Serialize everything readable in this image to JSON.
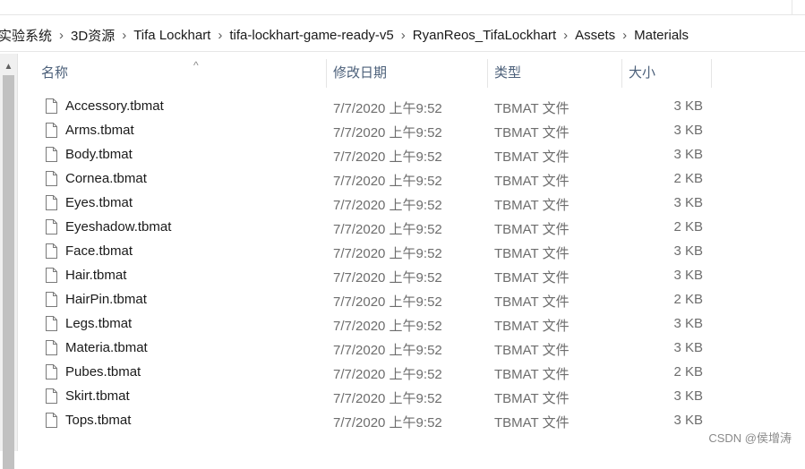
{
  "breadcrumbs": [
    "实验系统",
    "3D资源",
    "Tifa Lockhart",
    "tifa-lockhart-game-ready-v5",
    "RyanReos_TifaLockhart",
    "Assets",
    "Materials"
  ],
  "breadcrumb_separator": "›",
  "columns": {
    "name": "名称",
    "date": "修改日期",
    "type": "类型",
    "size": "大小"
  },
  "sort_indicator": "^",
  "scroll_up_arrow": "▲",
  "files": [
    {
      "name": "Accessory.tbmat",
      "date": "7/7/2020 上午9:52",
      "type": "TBMAT 文件",
      "size": "3 KB"
    },
    {
      "name": "Arms.tbmat",
      "date": "7/7/2020 上午9:52",
      "type": "TBMAT 文件",
      "size": "3 KB"
    },
    {
      "name": "Body.tbmat",
      "date": "7/7/2020 上午9:52",
      "type": "TBMAT 文件",
      "size": "3 KB"
    },
    {
      "name": "Cornea.tbmat",
      "date": "7/7/2020 上午9:52",
      "type": "TBMAT 文件",
      "size": "2 KB"
    },
    {
      "name": "Eyes.tbmat",
      "date": "7/7/2020 上午9:52",
      "type": "TBMAT 文件",
      "size": "3 KB"
    },
    {
      "name": "Eyeshadow.tbmat",
      "date": "7/7/2020 上午9:52",
      "type": "TBMAT 文件",
      "size": "2 KB"
    },
    {
      "name": "Face.tbmat",
      "date": "7/7/2020 上午9:52",
      "type": "TBMAT 文件",
      "size": "3 KB"
    },
    {
      "name": "Hair.tbmat",
      "date": "7/7/2020 上午9:52",
      "type": "TBMAT 文件",
      "size": "3 KB"
    },
    {
      "name": "HairPin.tbmat",
      "date": "7/7/2020 上午9:52",
      "type": "TBMAT 文件",
      "size": "2 KB"
    },
    {
      "name": "Legs.tbmat",
      "date": "7/7/2020 上午9:52",
      "type": "TBMAT 文件",
      "size": "3 KB"
    },
    {
      "name": "Materia.tbmat",
      "date": "7/7/2020 上午9:52",
      "type": "TBMAT 文件",
      "size": "3 KB"
    },
    {
      "name": "Pubes.tbmat",
      "date": "7/7/2020 上午9:52",
      "type": "TBMAT 文件",
      "size": "2 KB"
    },
    {
      "name": "Skirt.tbmat",
      "date": "7/7/2020 上午9:52",
      "type": "TBMAT 文件",
      "size": "3 KB"
    },
    {
      "name": "Tops.tbmat",
      "date": "7/7/2020 上午9:52",
      "type": "TBMAT 文件",
      "size": "3 KB"
    }
  ],
  "file_icon": "blank-file-icon",
  "watermark": "CSDN @侯增涛"
}
